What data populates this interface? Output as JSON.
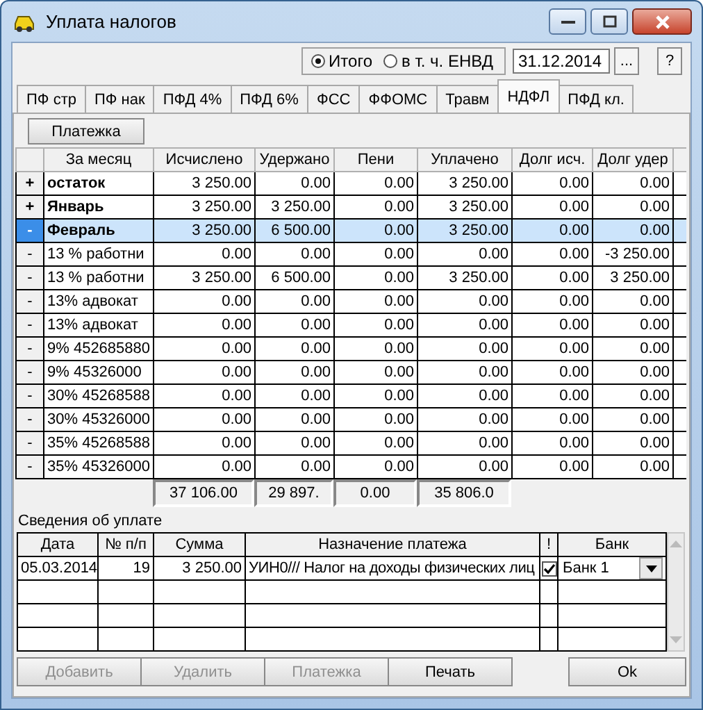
{
  "window": {
    "title": "Уплата налогов"
  },
  "mode": [
    {
      "label": "Итого",
      "selected": true
    },
    {
      "label": "в т. ч. ЕНВД",
      "selected": false
    }
  ],
  "date_field": {
    "value": "31.12.2014"
  },
  "toolbar_buttons": [
    "...",
    "?"
  ],
  "tabs": [
    {
      "label": "ПФ стр",
      "selected": false
    },
    {
      "label": "ПФ нак",
      "selected": false
    },
    {
      "label": "ПФД 4%",
      "selected": false
    },
    {
      "label": "ПФД 6%",
      "selected": false
    },
    {
      "label": "ФСС",
      "selected": false
    },
    {
      "label": "ФФОМС",
      "selected": false
    },
    {
      "label": "Травм",
      "selected": false
    },
    {
      "label": "НДФЛ",
      "selected": true
    },
    {
      "label": "ПФД кл.",
      "selected": false
    }
  ],
  "payments_button": "Платежка",
  "table": {
    "columns": [
      "За месяц",
      "Исчислено",
      "Удержано",
      "Пени",
      "Уплачено",
      "Долг исч.",
      "Долг удер"
    ],
    "rows": [
      {
        "marker": "+",
        "kind": "group",
        "selected": false,
        "cells": [
          "остаток",
          "3 250.00",
          "0.00",
          "0.00",
          "3 250.00",
          "0.00",
          "0.00"
        ]
      },
      {
        "marker": "+",
        "kind": "group",
        "selected": false,
        "cells": [
          "Январь",
          "3 250.00",
          "3 250.00",
          "0.00",
          "3 250.00",
          "0.00",
          "0.00"
        ]
      },
      {
        "marker": "-",
        "kind": "group",
        "selected": true,
        "cells": [
          "Февраль",
          "3 250.00",
          "6 500.00",
          "0.00",
          "3 250.00",
          "0.00",
          "0.00"
        ]
      },
      {
        "marker": "-",
        "kind": "item",
        "selected": false,
        "cells": [
          "13 % работни",
          "0.00",
          "0.00",
          "0.00",
          "0.00",
          "0.00",
          "-3 250.00"
        ]
      },
      {
        "marker": "-",
        "kind": "item",
        "selected": false,
        "cells": [
          "13 % работни",
          "3 250.00",
          "6 500.00",
          "0.00",
          "3 250.00",
          "0.00",
          "3 250.00"
        ]
      },
      {
        "marker": "-",
        "kind": "item",
        "selected": false,
        "cells": [
          "13% адвокат",
          "0.00",
          "0.00",
          "0.00",
          "0.00",
          "0.00",
          "0.00"
        ]
      },
      {
        "marker": "-",
        "kind": "item",
        "selected": false,
        "cells": [
          "13% адвокат",
          "0.00",
          "0.00",
          "0.00",
          "0.00",
          "0.00",
          "0.00"
        ]
      },
      {
        "marker": "-",
        "kind": "item",
        "selected": false,
        "cells": [
          "9% 452685880",
          "0.00",
          "0.00",
          "0.00",
          "0.00",
          "0.00",
          "0.00"
        ]
      },
      {
        "marker": "-",
        "kind": "item",
        "selected": false,
        "cells": [
          "9% 45326000",
          "0.00",
          "0.00",
          "0.00",
          "0.00",
          "0.00",
          "0.00"
        ]
      },
      {
        "marker": "-",
        "kind": "item",
        "selected": false,
        "cells": [
          "30% 45268588",
          "0.00",
          "0.00",
          "0.00",
          "0.00",
          "0.00",
          "0.00"
        ]
      },
      {
        "marker": "-",
        "kind": "item",
        "selected": false,
        "cells": [
          "30% 45326000",
          "0.00",
          "0.00",
          "0.00",
          "0.00",
          "0.00",
          "0.00"
        ]
      },
      {
        "marker": "-",
        "kind": "item",
        "selected": false,
        "cells": [
          "35% 45268588",
          "0.00",
          "0.00",
          "0.00",
          "0.00",
          "0.00",
          "0.00"
        ]
      },
      {
        "marker": "-",
        "kind": "item",
        "selected": false,
        "cells": [
          "35% 45326000",
          "0.00",
          "0.00",
          "0.00",
          "0.00",
          "0.00",
          "0.00"
        ]
      }
    ],
    "totals": [
      "37 106.00",
      "29 897.",
      "0.00",
      "35 806.0"
    ]
  },
  "payments": {
    "title": "Сведения об уплате",
    "columns": [
      "Дата",
      "№ п/п",
      "Сумма",
      "Назначение платежа",
      "!",
      "Банк"
    ],
    "rows": [
      {
        "date": "05.03.2014",
        "number": "19",
        "amount": "3 250.00",
        "purpose": "УИН0/// Налог на доходы физических лиц",
        "checked": true,
        "bank": "Банк 1"
      }
    ]
  },
  "buttons": [
    {
      "label": "Добавить",
      "disabled": true
    },
    {
      "label": "Удалить",
      "disabled": true
    },
    {
      "label": "Платежка",
      "disabled": true
    },
    {
      "label": "Печать",
      "disabled": false
    },
    {
      "label": "Ok",
      "disabled": false
    }
  ]
}
